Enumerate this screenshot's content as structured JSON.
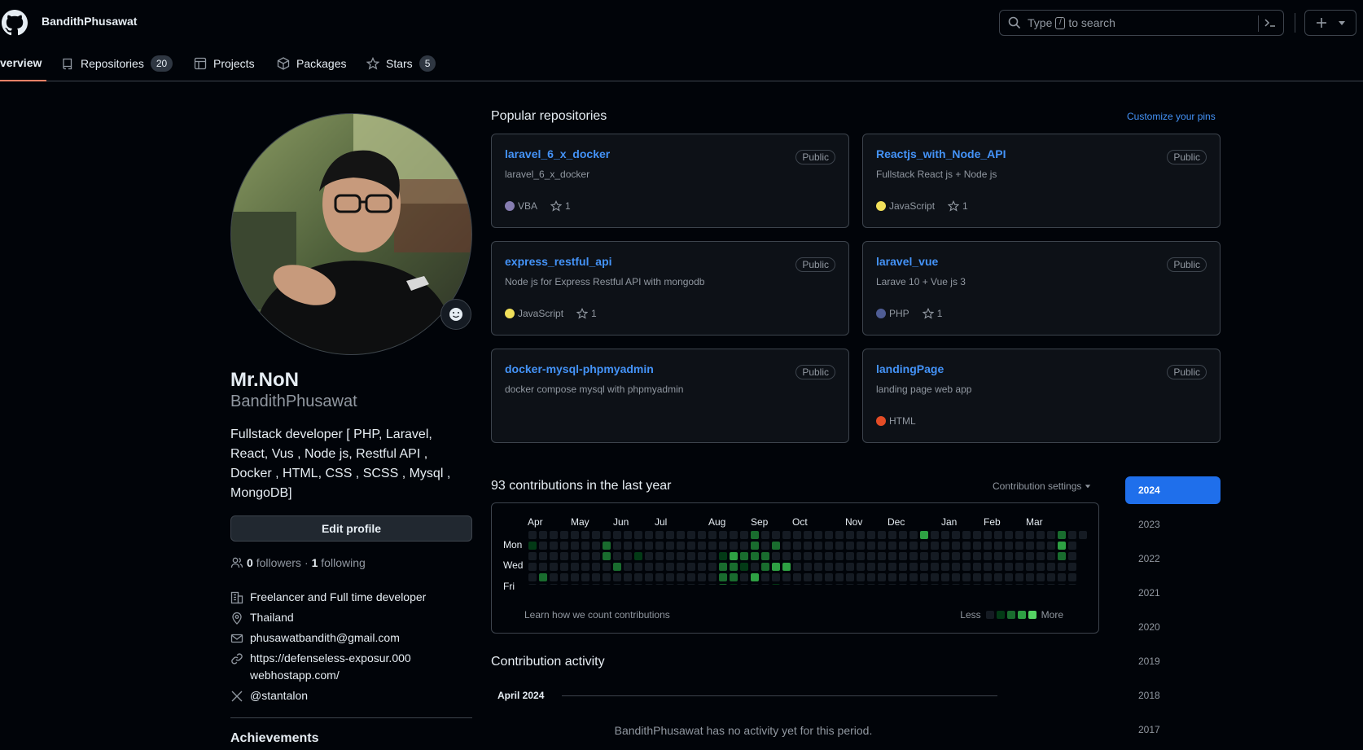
{
  "header": {
    "username": "BandithPhusawat",
    "search_prefix": "Type",
    "search_slash": "/",
    "search_suffix": "to search"
  },
  "nav": {
    "overview": "verview",
    "repositories": "Repositories",
    "repositories_count": "20",
    "projects": "Projects",
    "packages": "Packages",
    "stars": "Stars",
    "stars_count": "5"
  },
  "profile": {
    "name": "Mr.NoN",
    "login": "BandithPhusawat",
    "bio": "Fullstack developer [ PHP, Laravel, React, Vus , Node js, Restful API , Docker , HTML, CSS , SCSS , Mysql , MongoDB]",
    "edit_label": "Edit profile",
    "followers_count": "0",
    "followers_label": "followers",
    "separator": "·",
    "following_count": "1",
    "following_label": "following",
    "company": "Freelancer and Full time developer",
    "location": "Thailand",
    "email": "phusawatbandith@gmail.com",
    "website": "https://defenseless-exposur.000webhostapp.com/",
    "twitter": "@stantalon",
    "achievements": "Achievements"
  },
  "popular": {
    "title": "Popular repositories",
    "customize": "Customize your pins",
    "repos": [
      {
        "name": "laravel_6_x_docker",
        "visibility": "Public",
        "desc": "laravel_6_x_docker",
        "lang": "VBA",
        "lang_color": "#867db1",
        "stars": "1"
      },
      {
        "name": "Reactjs_with_Node_API",
        "visibility": "Public",
        "desc": "Fullstack React js + Node js",
        "lang": "JavaScript",
        "lang_color": "#f1e05a",
        "stars": "1"
      },
      {
        "name": "express_restful_api",
        "visibility": "Public",
        "desc": "Node js for Express Restful API with mongodb",
        "lang": "JavaScript",
        "lang_color": "#f1e05a",
        "stars": "1"
      },
      {
        "name": "laravel_vue",
        "visibility": "Public",
        "desc": "Larave 10 + Vue js 3",
        "lang": "PHP",
        "lang_color": "#4F5D95",
        "stars": "1"
      },
      {
        "name": "docker-mysql-phpmyadmin",
        "visibility": "Public",
        "desc": "docker compose mysql with phpmyadmin",
        "lang": "",
        "lang_color": "",
        "stars": ""
      },
      {
        "name": "landingPage",
        "visibility": "Public",
        "desc": "landing page web app",
        "lang": "HTML",
        "lang_color": "#e34c26",
        "stars": ""
      }
    ]
  },
  "contributions": {
    "title": "93 contributions in the last year",
    "settings": "Contribution settings",
    "months": [
      "Apr",
      "May",
      "Jun",
      "Jul",
      "Aug",
      "Sep",
      "Oct",
      "Nov",
      "Dec",
      "Jan",
      "Feb",
      "Mar"
    ],
    "days": [
      "Mon",
      "Wed",
      "Fri"
    ],
    "learn": "Learn how we count contributions",
    "less": "Less",
    "more": "More",
    "colors": [
      "#151b23",
      "#033a16",
      "#196c2e",
      "#2ea043",
      "#56d364"
    ]
  },
  "years": [
    "2024",
    "2023",
    "2022",
    "2021",
    "2020",
    "2019",
    "2018",
    "2017"
  ],
  "activity": {
    "title": "Contribution activity",
    "month": "April 2024",
    "empty": "BandithPhusawat has no activity yet for this period."
  }
}
